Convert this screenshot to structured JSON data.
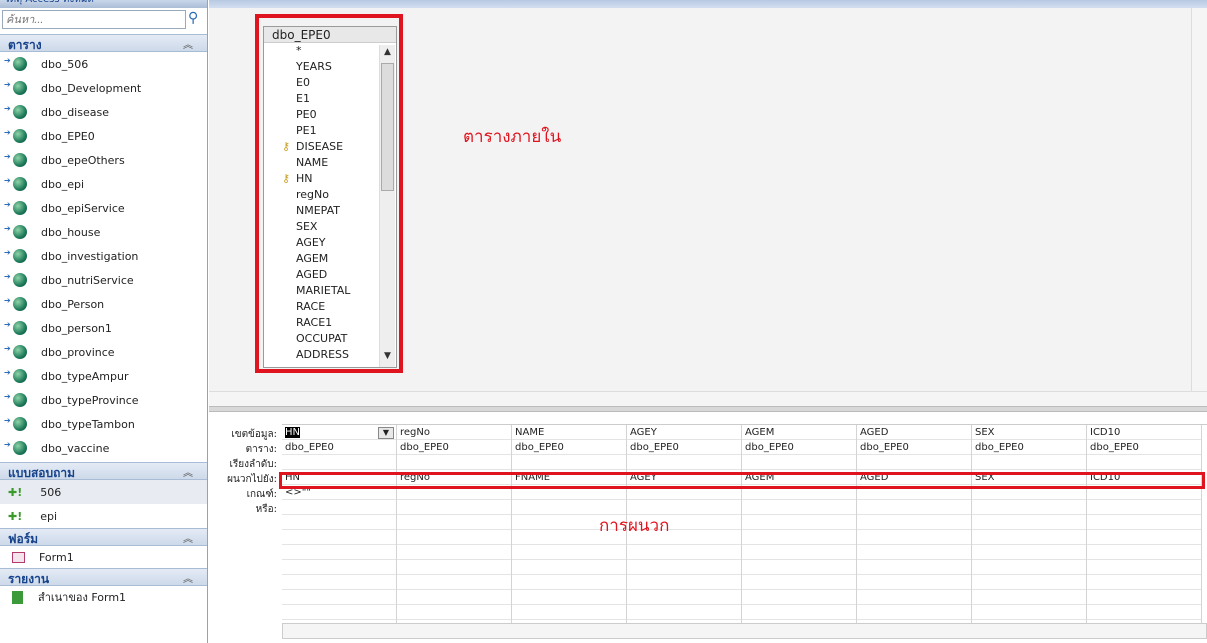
{
  "nav": {
    "title": "วัตถุ Access ทั้งหมด",
    "search_placeholder": "ค้นหา...",
    "groups": [
      {
        "label": "ตาราง",
        "items": [
          "dbo_506",
          "dbo_Development",
          "dbo_disease",
          "dbo_EPE0",
          "dbo_epeOthers",
          "dbo_epi",
          "dbo_epiService",
          "dbo_house",
          "dbo_investigation",
          "dbo_nutriService",
          "dbo_Person",
          "dbo_person1",
          "dbo_province",
          "dbo_typeAmpur",
          "dbo_typeProvince",
          "dbo_typeTambon",
          "dbo_vaccine"
        ]
      },
      {
        "label": "แบบสอบถาม",
        "items": [
          "506",
          "epi"
        ]
      },
      {
        "label": "ฟอร์ม",
        "items": [
          "Form1"
        ]
      },
      {
        "label": "รายงาน",
        "items": [
          "สำเนาของ Form1"
        ]
      }
    ]
  },
  "table": {
    "title": "dbo_EPE0",
    "fields": [
      "*",
      "YEARS",
      "E0",
      "E1",
      "PE0",
      "PE1",
      "DISEASE",
      "NAME",
      "HN",
      "regNo",
      "NMEPAT",
      "SEX",
      "AGEY",
      "AGEM",
      "AGED",
      "MARIETAL",
      "RACE",
      "RACE1",
      "OCCUPAT",
      "ADDRESS"
    ],
    "key_fields": [
      "DISEASE",
      "HN"
    ]
  },
  "annotations": {
    "internal_table": "ตารางภายใน",
    "append": "การผนวก"
  },
  "grid": {
    "row_labels": [
      "เขตข้อมูล:",
      "ตาราง:",
      "เรียงลำดับ:",
      "ผนวกไปยัง:",
      "เกณฑ์:",
      "หรือ:"
    ],
    "columns": [
      {
        "field": "HN",
        "table": "dbo_EPE0",
        "append_to": "HN",
        "criteria": "<>\"\""
      },
      {
        "field": "regNo",
        "table": "dbo_EPE0",
        "append_to": "regNo",
        "criteria": ""
      },
      {
        "field": "NAME",
        "table": "dbo_EPE0",
        "append_to": "FNAME",
        "criteria": ""
      },
      {
        "field": "AGEY",
        "table": "dbo_EPE0",
        "append_to": "AGEY",
        "criteria": ""
      },
      {
        "field": "AGEM",
        "table": "dbo_EPE0",
        "append_to": "AGEM",
        "criteria": ""
      },
      {
        "field": "AGED",
        "table": "dbo_EPE0",
        "append_to": "AGED",
        "criteria": ""
      },
      {
        "field": "SEX",
        "table": "dbo_EPE0",
        "append_to": "SEX",
        "criteria": ""
      },
      {
        "field": "ICD10",
        "table": "dbo_EPE0",
        "append_to": "ICD10",
        "criteria": ""
      }
    ]
  }
}
